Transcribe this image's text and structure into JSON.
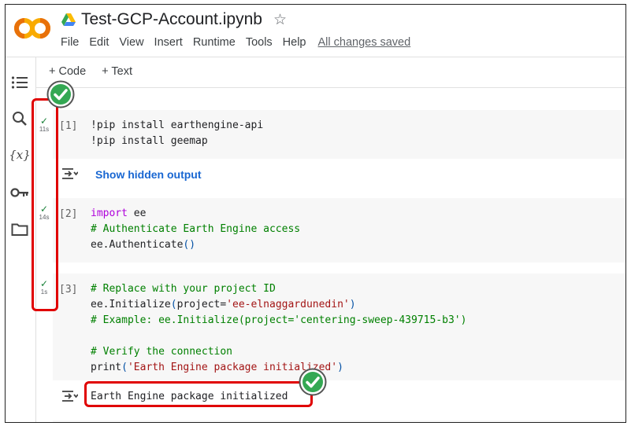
{
  "app": {
    "title": "Test-GCP-Account.ipynb",
    "logo_text": "CO"
  },
  "menu": [
    "File",
    "Edit",
    "View",
    "Insert",
    "Runtime",
    "Tools",
    "Help"
  ],
  "save_status": "All changes saved",
  "toolbar": {
    "code_label": "+ Code",
    "text_label": "+ Text"
  },
  "sidebar": {
    "variables_label": "{x}"
  },
  "cells": [
    {
      "exec": "[1]",
      "time": "11s",
      "lines": [
        "!pip install earthengine-api",
        "!pip install geemap"
      ]
    },
    {
      "exec": "[2]",
      "time": "14s",
      "lines": [
        "import ee",
        "# Authenticate Earth Engine access",
        "ee.Authenticate()"
      ]
    },
    {
      "exec": "[3]",
      "time": "1s",
      "lines": [
        "# Replace with your project ID",
        "ee.Initialize(project='ee-elnaggardunedin')",
        "# Example: ee.Initialize(project='centering-sweep-439715-b3')",
        "",
        "# Verify the connection",
        "print('Earth Engine package initialized')"
      ]
    }
  ],
  "outputs": {
    "show_hidden": "Show hidden output",
    "cell3_text": "Earth Engine package initialized"
  },
  "colors": {
    "highlight": "#e00000",
    "success": "#34a853",
    "link": "#1967d2"
  }
}
